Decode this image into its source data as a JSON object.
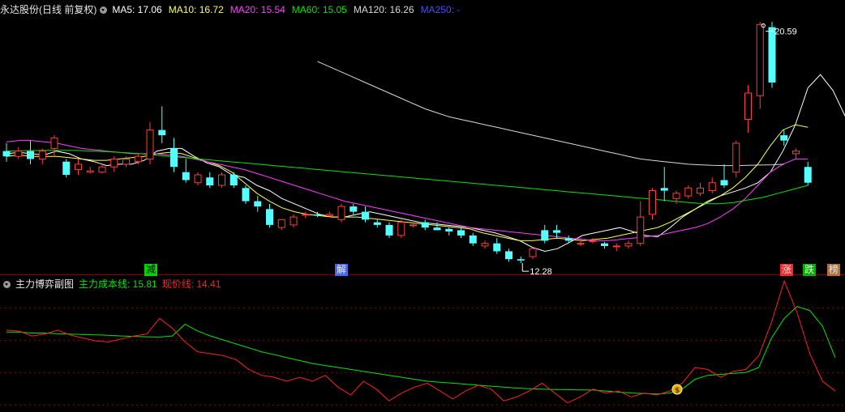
{
  "header": {
    "title": "永达股份(日线 前复权)",
    "ma_items": [
      {
        "label": "MA5: 17.06",
        "color": "#ffffff"
      },
      {
        "label": "MA10: 16.72",
        "color": "#ffff4f"
      },
      {
        "label": "MA20: 15.54",
        "color": "#ff3fff"
      },
      {
        "label": "MA60: 15.05",
        "color": "#00e600"
      },
      {
        "label": "MA120: 16.26",
        "color": "#d8d8d8"
      },
      {
        "label": "MA250: -",
        "color": "#4a4aff"
      }
    ]
  },
  "sub_header": {
    "title": "主力博弈副图",
    "cost_label": "主力成本线: 15.81",
    "cost_color": "#00e600",
    "price_label": "现价线: 14.41",
    "price_color": "#ff2020"
  },
  "annotations": {
    "high_label": "20.59",
    "low_label": "12.28",
    "event_tags": [
      {
        "text": "减",
        "color": "#00e600",
        "bg": "#00e600",
        "fg": "#000000"
      },
      {
        "text": "解",
        "color": "#ffffff",
        "bg": "#4d6fff",
        "fg": "#ffffff"
      },
      {
        "text": "涨",
        "color": "#ff2020",
        "bg": "#ff3030",
        "fg": "#ffffff"
      },
      {
        "text": "跌",
        "color": "#00e600",
        "bg": "#00c000",
        "fg": "#ffffff"
      },
      {
        "text": "榜",
        "color": "#e08020",
        "bg": "#c07a40",
        "fg": "#ffffff"
      }
    ],
    "coin_icon": "money-bag-icon"
  },
  "chart_data": [
    {
      "type": "candlestick",
      "name": "main",
      "ylim": [
        11.4,
        21.1
      ],
      "ohlc": [
        [
          15.8,
          16.1,
          15.4,
          15.6
        ],
        [
          15.6,
          15.95,
          15.5,
          15.8
        ],
        [
          15.8,
          16.2,
          15.3,
          15.5
        ],
        [
          15.5,
          15.9,
          15.3,
          15.8
        ],
        [
          15.9,
          16.4,
          15.6,
          16.3
        ],
        [
          15.4,
          15.5,
          14.8,
          14.9
        ],
        [
          15.1,
          15.5,
          14.9,
          15.3
        ],
        [
          15.0,
          15.2,
          14.95,
          15.05
        ],
        [
          15.0,
          15.3,
          14.95,
          15.2
        ],
        [
          15.2,
          15.6,
          15.0,
          15.5
        ],
        [
          15.3,
          15.6,
          15.2,
          15.5
        ],
        [
          15.4,
          15.7,
          15.3,
          15.6
        ],
        [
          15.5,
          16.9,
          15.3,
          16.6
        ],
        [
          16.6,
          17.5,
          16.1,
          16.4
        ],
        [
          15.9,
          16.3,
          15.0,
          15.2
        ],
        [
          15.0,
          15.5,
          14.6,
          14.7
        ],
        [
          14.6,
          15.0,
          14.5,
          14.9
        ],
        [
          14.8,
          15.0,
          14.4,
          14.5
        ],
        [
          14.5,
          15.0,
          14.4,
          14.9
        ],
        [
          14.9,
          15.0,
          14.4,
          14.5
        ],
        [
          14.4,
          14.5,
          13.8,
          13.9
        ],
        [
          13.9,
          14.1,
          13.5,
          13.7
        ],
        [
          13.6,
          13.8,
          12.9,
          13.0
        ],
        [
          12.9,
          13.2,
          12.8,
          13.2
        ],
        [
          13.0,
          13.4,
          12.9,
          13.3
        ],
        [
          13.4,
          13.5,
          13.25,
          13.4
        ],
        [
          13.4,
          13.5,
          13.3,
          13.35
        ],
        [
          13.35,
          13.5,
          13.3,
          13.4
        ],
        [
          13.2,
          13.8,
          13.1,
          13.7
        ],
        [
          13.7,
          13.8,
          13.4,
          13.5
        ],
        [
          13.5,
          13.7,
          13.1,
          13.2
        ],
        [
          13.1,
          13.2,
          12.9,
          13.0
        ],
        [
          13.0,
          13.1,
          12.5,
          12.6
        ],
        [
          12.6,
          13.2,
          12.5,
          13.1
        ],
        [
          13.0,
          13.1,
          12.9,
          13.0
        ],
        [
          13.1,
          13.2,
          12.8,
          12.9
        ],
        [
          12.9,
          13.1,
          12.8,
          12.8
        ],
        [
          12.85,
          12.9,
          12.6,
          12.75
        ],
        [
          12.8,
          12.9,
          12.5,
          12.6
        ],
        [
          12.6,
          12.7,
          12.2,
          12.3
        ],
        [
          12.2,
          12.4,
          12.1,
          12.3
        ],
        [
          12.3,
          12.5,
          11.9,
          12.0
        ],
        [
          12.0,
          12.1,
          11.6,
          11.7
        ],
        [
          11.7,
          11.8,
          11.55,
          11.65
        ],
        [
          11.8,
          12.1,
          11.7,
          12.1
        ],
        [
          12.8,
          13.0,
          12.3,
          12.4
        ],
        [
          12.8,
          13.0,
          12.5,
          12.7
        ],
        [
          12.5,
          12.6,
          12.3,
          12.4
        ],
        [
          12.3,
          12.5,
          12.2,
          12.3
        ],
        [
          12.4,
          12.5,
          12.3,
          12.4
        ],
        [
          12.3,
          12.35,
          12.1,
          12.2
        ],
        [
          12.2,
          12.3,
          12.0,
          12.2
        ],
        [
          12.2,
          12.4,
          12.1,
          12.3
        ],
        [
          12.3,
          13.9,
          12.2,
          13.3
        ],
        [
          13.4,
          14.4,
          13.2,
          14.3
        ],
        [
          14.4,
          15.2,
          13.9,
          14.3
        ],
        [
          14.0,
          14.3,
          13.8,
          14.2
        ],
        [
          14.1,
          14.5,
          14.0,
          14.4
        ],
        [
          14.2,
          14.6,
          14.1,
          14.4
        ],
        [
          14.3,
          14.8,
          14.2,
          14.6
        ],
        [
          14.7,
          15.3,
          14.4,
          14.5
        ],
        [
          15.0,
          16.2,
          14.8,
          16.1
        ],
        [
          17.0,
          18.3,
          16.5,
          18.0
        ],
        [
          17.9,
          20.7,
          17.4,
          20.6
        ],
        [
          20.5,
          20.7,
          18.2,
          18.4
        ],
        [
          16.4,
          16.6,
          16.0,
          16.2
        ],
        [
          15.7,
          15.9,
          15.5,
          15.8
        ],
        [
          15.2,
          15.4,
          14.5,
          14.6
        ]
      ],
      "series": [
        {
          "name": "MA5",
          "start": 0,
          "values": [
            15.7,
            15.75,
            15.7,
            15.65,
            15.8,
            15.7,
            15.5,
            15.4,
            15.25,
            15.3,
            15.3,
            15.45,
            15.8,
            15.9,
            15.9,
            15.6,
            15.35,
            15.2,
            14.9,
            14.8,
            14.5,
            14.3,
            14.0,
            13.8,
            13.6,
            13.4,
            13.3,
            13.3,
            13.4,
            13.5,
            13.4,
            13.3,
            13.2,
            13.1,
            13.05,
            13.0,
            12.95,
            12.9,
            12.8,
            12.7,
            12.55,
            12.4,
            12.15,
            12.0,
            12.1,
            12.35,
            12.6,
            12.7,
            12.8,
            12.9,
            12.75,
            12.6,
            12.55,
            12.9,
            13.3,
            13.6,
            13.9,
            14.1,
            14.25,
            14.4,
            14.6,
            15.0,
            15.8,
            16.8,
            18.2,
            18.7,
            18.1,
            17.1
          ]
        },
        {
          "name": "MA10",
          "start": 0,
          "values": [
            15.6,
            15.65,
            15.6,
            15.6,
            15.6,
            15.55,
            15.5,
            15.45,
            15.45,
            15.5,
            15.55,
            15.6,
            15.7,
            15.75,
            15.7,
            15.55,
            15.4,
            15.25,
            15.0,
            14.6,
            14.2,
            13.9,
            13.65,
            13.5,
            13.4,
            13.35,
            13.3,
            13.3,
            13.3,
            13.25,
            13.2,
            13.15,
            13.1,
            13.05,
            13.0,
            12.95,
            12.9,
            12.85,
            12.7,
            12.6,
            12.5,
            12.4,
            12.4,
            12.45,
            12.5,
            12.45,
            12.4,
            12.45,
            12.5,
            12.6,
            12.7,
            12.8,
            12.9,
            13.1,
            13.35,
            13.6,
            13.85,
            14.1,
            14.4,
            14.8,
            15.3,
            16.0,
            16.6,
            16.8,
            16.7
          ]
        },
        {
          "name": "MA20",
          "start": 0,
          "values": [
            16.15,
            16.2,
            16.2,
            16.15,
            16.1,
            16.0,
            15.9,
            15.85,
            15.8,
            15.75,
            15.7,
            15.7,
            15.7,
            15.65,
            15.6,
            15.5,
            15.4,
            15.3,
            15.2,
            15.1,
            14.95,
            14.8,
            14.65,
            14.5,
            14.35,
            14.2,
            14.05,
            13.9,
            13.8,
            13.7,
            13.6,
            13.5,
            13.4,
            13.3,
            13.2,
            13.1,
            13.0,
            12.9,
            12.85,
            12.8,
            12.75,
            12.7,
            12.65,
            12.6,
            12.55,
            12.5,
            12.45,
            12.4,
            12.4,
            12.45,
            12.5,
            12.55,
            12.6,
            12.7,
            12.8,
            12.9,
            13.05,
            13.3,
            13.6,
            14.0,
            14.5,
            15.0,
            15.3,
            15.5,
            15.5
          ]
        },
        {
          "name": "MA60",
          "start": 0,
          "values": [
            15.8,
            15.81,
            15.82,
            15.83,
            15.83,
            15.82,
            15.8,
            15.77,
            15.74,
            15.7,
            15.65,
            15.6,
            15.55,
            15.5,
            15.45,
            15.4,
            15.35,
            15.3,
            15.25,
            15.2,
            15.15,
            15.1,
            15.05,
            15.0,
            14.95,
            14.9,
            14.85,
            14.8,
            14.75,
            14.7,
            14.65,
            14.6,
            14.55,
            14.5,
            14.45,
            14.4,
            14.35,
            14.3,
            14.25,
            14.2,
            14.15,
            14.1,
            14.05,
            14.0,
            13.95,
            13.9,
            13.85,
            13.8,
            13.8,
            13.85,
            13.95,
            14.05,
            14.2,
            14.35,
            14.5
          ]
        },
        {
          "name": "MA120",
          "start": 26,
          "values": [
            19.2,
            19.0,
            18.8,
            18.6,
            18.4,
            18.2,
            18.0,
            17.8,
            17.6,
            17.4,
            17.25,
            17.1,
            17.0,
            16.9,
            16.8,
            16.7,
            16.6,
            16.5,
            16.4,
            16.3,
            16.2,
            16.1,
            16.0,
            15.9,
            15.8,
            15.7,
            15.6,
            15.5,
            15.45,
            15.4,
            15.35,
            15.3,
            15.28,
            15.26,
            15.25,
            15.25,
            15.26,
            15.27,
            15.28,
            15.3
          ]
        }
      ]
    },
    {
      "type": "line",
      "name": "sub",
      "ylim": [
        11.6,
        17.9
      ],
      "series": [
        {
          "name": "主力成本线",
          "values": [
            15.5,
            15.5,
            15.45,
            15.45,
            15.42,
            15.4,
            15.38,
            15.36,
            15.34,
            15.3,
            15.28,
            15.26,
            15.25,
            15.3,
            15.9,
            15.55,
            15.3,
            15.1,
            14.9,
            14.7,
            14.5,
            14.35,
            14.2,
            14.05,
            13.9,
            13.8,
            13.7,
            13.6,
            13.5,
            13.4,
            13.3,
            13.2,
            13.1,
            13.0,
            12.95,
            12.9,
            12.85,
            12.8,
            12.75,
            12.7,
            12.65,
            12.62,
            12.6,
            12.58,
            12.57,
            12.56,
            12.55,
            12.5,
            12.45,
            12.4,
            12.38,
            12.35,
            12.4,
            12.6,
            13.1,
            13.3,
            13.35,
            13.4,
            13.45,
            13.7,
            15.2,
            16.2,
            16.8,
            16.6,
            15.8,
            14.2
          ]
        },
        {
          "name": "现价线",
          "values": [
            15.6,
            15.55,
            15.3,
            15.4,
            15.6,
            15.35,
            15.2,
            15.05,
            15.0,
            15.15,
            15.3,
            15.4,
            16.2,
            15.7,
            15.0,
            14.5,
            14.4,
            14.3,
            14.1,
            13.6,
            13.3,
            13.2,
            13.0,
            13.2,
            13.0,
            13.3,
            12.7,
            12.3,
            13.0,
            12.6,
            12.0,
            12.4,
            12.7,
            12.9,
            12.5,
            12.1,
            12.5,
            12.8,
            12.6,
            12.0,
            12.2,
            12.5,
            12.9,
            12.4,
            11.9,
            12.2,
            12.6,
            12.4,
            12.5,
            12.2,
            12.4,
            12.3,
            12.5,
            12.9,
            13.7,
            13.6,
            13.2,
            13.5,
            13.6,
            14.3,
            16.0,
            18.1,
            16.5,
            14.4,
            13.0,
            12.5
          ]
        }
      ]
    }
  ]
}
